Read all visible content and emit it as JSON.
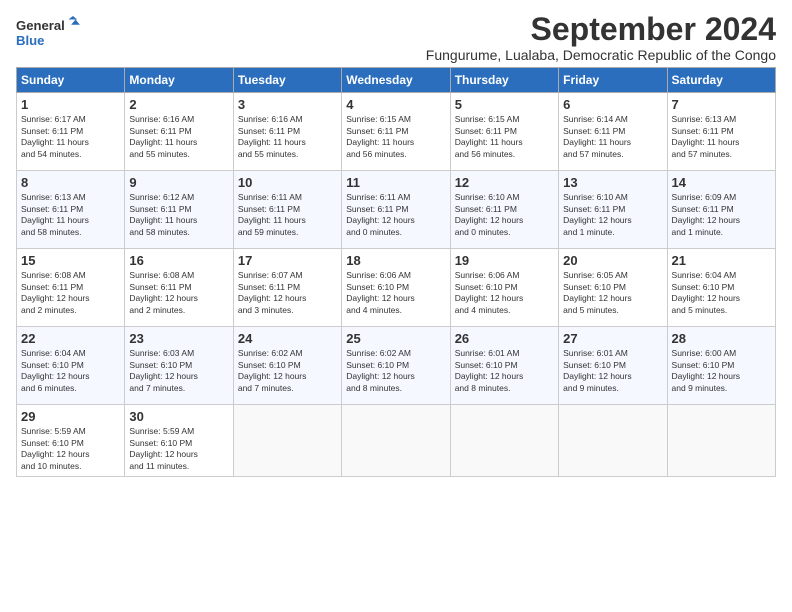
{
  "logo": {
    "line1": "General",
    "line2": "Blue"
  },
  "title": "September 2024",
  "subtitle": "Fungurume, Lualaba, Democratic Republic of the Congo",
  "headers": [
    "Sunday",
    "Monday",
    "Tuesday",
    "Wednesday",
    "Thursday",
    "Friday",
    "Saturday"
  ],
  "weeks": [
    [
      {
        "day": "1",
        "content": "Sunrise: 6:17 AM\nSunset: 6:11 PM\nDaylight: 11 hours\nand 54 minutes."
      },
      {
        "day": "2",
        "content": "Sunrise: 6:16 AM\nSunset: 6:11 PM\nDaylight: 11 hours\nand 55 minutes."
      },
      {
        "day": "3",
        "content": "Sunrise: 6:16 AM\nSunset: 6:11 PM\nDaylight: 11 hours\nand 55 minutes."
      },
      {
        "day": "4",
        "content": "Sunrise: 6:15 AM\nSunset: 6:11 PM\nDaylight: 11 hours\nand 56 minutes."
      },
      {
        "day": "5",
        "content": "Sunrise: 6:15 AM\nSunset: 6:11 PM\nDaylight: 11 hours\nand 56 minutes."
      },
      {
        "day": "6",
        "content": "Sunrise: 6:14 AM\nSunset: 6:11 PM\nDaylight: 11 hours\nand 57 minutes."
      },
      {
        "day": "7",
        "content": "Sunrise: 6:13 AM\nSunset: 6:11 PM\nDaylight: 11 hours\nand 57 minutes."
      }
    ],
    [
      {
        "day": "8",
        "content": "Sunrise: 6:13 AM\nSunset: 6:11 PM\nDaylight: 11 hours\nand 58 minutes."
      },
      {
        "day": "9",
        "content": "Sunrise: 6:12 AM\nSunset: 6:11 PM\nDaylight: 11 hours\nand 58 minutes."
      },
      {
        "day": "10",
        "content": "Sunrise: 6:11 AM\nSunset: 6:11 PM\nDaylight: 11 hours\nand 59 minutes."
      },
      {
        "day": "11",
        "content": "Sunrise: 6:11 AM\nSunset: 6:11 PM\nDaylight: 12 hours\nand 0 minutes."
      },
      {
        "day": "12",
        "content": "Sunrise: 6:10 AM\nSunset: 6:11 PM\nDaylight: 12 hours\nand 0 minutes."
      },
      {
        "day": "13",
        "content": "Sunrise: 6:10 AM\nSunset: 6:11 PM\nDaylight: 12 hours\nand 1 minute."
      },
      {
        "day": "14",
        "content": "Sunrise: 6:09 AM\nSunset: 6:11 PM\nDaylight: 12 hours\nand 1 minute."
      }
    ],
    [
      {
        "day": "15",
        "content": "Sunrise: 6:08 AM\nSunset: 6:11 PM\nDaylight: 12 hours\nand 2 minutes."
      },
      {
        "day": "16",
        "content": "Sunrise: 6:08 AM\nSunset: 6:11 PM\nDaylight: 12 hours\nand 2 minutes."
      },
      {
        "day": "17",
        "content": "Sunrise: 6:07 AM\nSunset: 6:11 PM\nDaylight: 12 hours\nand 3 minutes."
      },
      {
        "day": "18",
        "content": "Sunrise: 6:06 AM\nSunset: 6:10 PM\nDaylight: 12 hours\nand 4 minutes."
      },
      {
        "day": "19",
        "content": "Sunrise: 6:06 AM\nSunset: 6:10 PM\nDaylight: 12 hours\nand 4 minutes."
      },
      {
        "day": "20",
        "content": "Sunrise: 6:05 AM\nSunset: 6:10 PM\nDaylight: 12 hours\nand 5 minutes."
      },
      {
        "day": "21",
        "content": "Sunrise: 6:04 AM\nSunset: 6:10 PM\nDaylight: 12 hours\nand 5 minutes."
      }
    ],
    [
      {
        "day": "22",
        "content": "Sunrise: 6:04 AM\nSunset: 6:10 PM\nDaylight: 12 hours\nand 6 minutes."
      },
      {
        "day": "23",
        "content": "Sunrise: 6:03 AM\nSunset: 6:10 PM\nDaylight: 12 hours\nand 7 minutes."
      },
      {
        "day": "24",
        "content": "Sunrise: 6:02 AM\nSunset: 6:10 PM\nDaylight: 12 hours\nand 7 minutes."
      },
      {
        "day": "25",
        "content": "Sunrise: 6:02 AM\nSunset: 6:10 PM\nDaylight: 12 hours\nand 8 minutes."
      },
      {
        "day": "26",
        "content": "Sunrise: 6:01 AM\nSunset: 6:10 PM\nDaylight: 12 hours\nand 8 minutes."
      },
      {
        "day": "27",
        "content": "Sunrise: 6:01 AM\nSunset: 6:10 PM\nDaylight: 12 hours\nand 9 minutes."
      },
      {
        "day": "28",
        "content": "Sunrise: 6:00 AM\nSunset: 6:10 PM\nDaylight: 12 hours\nand 9 minutes."
      }
    ],
    [
      {
        "day": "29",
        "content": "Sunrise: 5:59 AM\nSunset: 6:10 PM\nDaylight: 12 hours\nand 10 minutes."
      },
      {
        "day": "30",
        "content": "Sunrise: 5:59 AM\nSunset: 6:10 PM\nDaylight: 12 hours\nand 11 minutes."
      },
      {
        "day": "",
        "content": ""
      },
      {
        "day": "",
        "content": ""
      },
      {
        "day": "",
        "content": ""
      },
      {
        "day": "",
        "content": ""
      },
      {
        "day": "",
        "content": ""
      }
    ]
  ]
}
